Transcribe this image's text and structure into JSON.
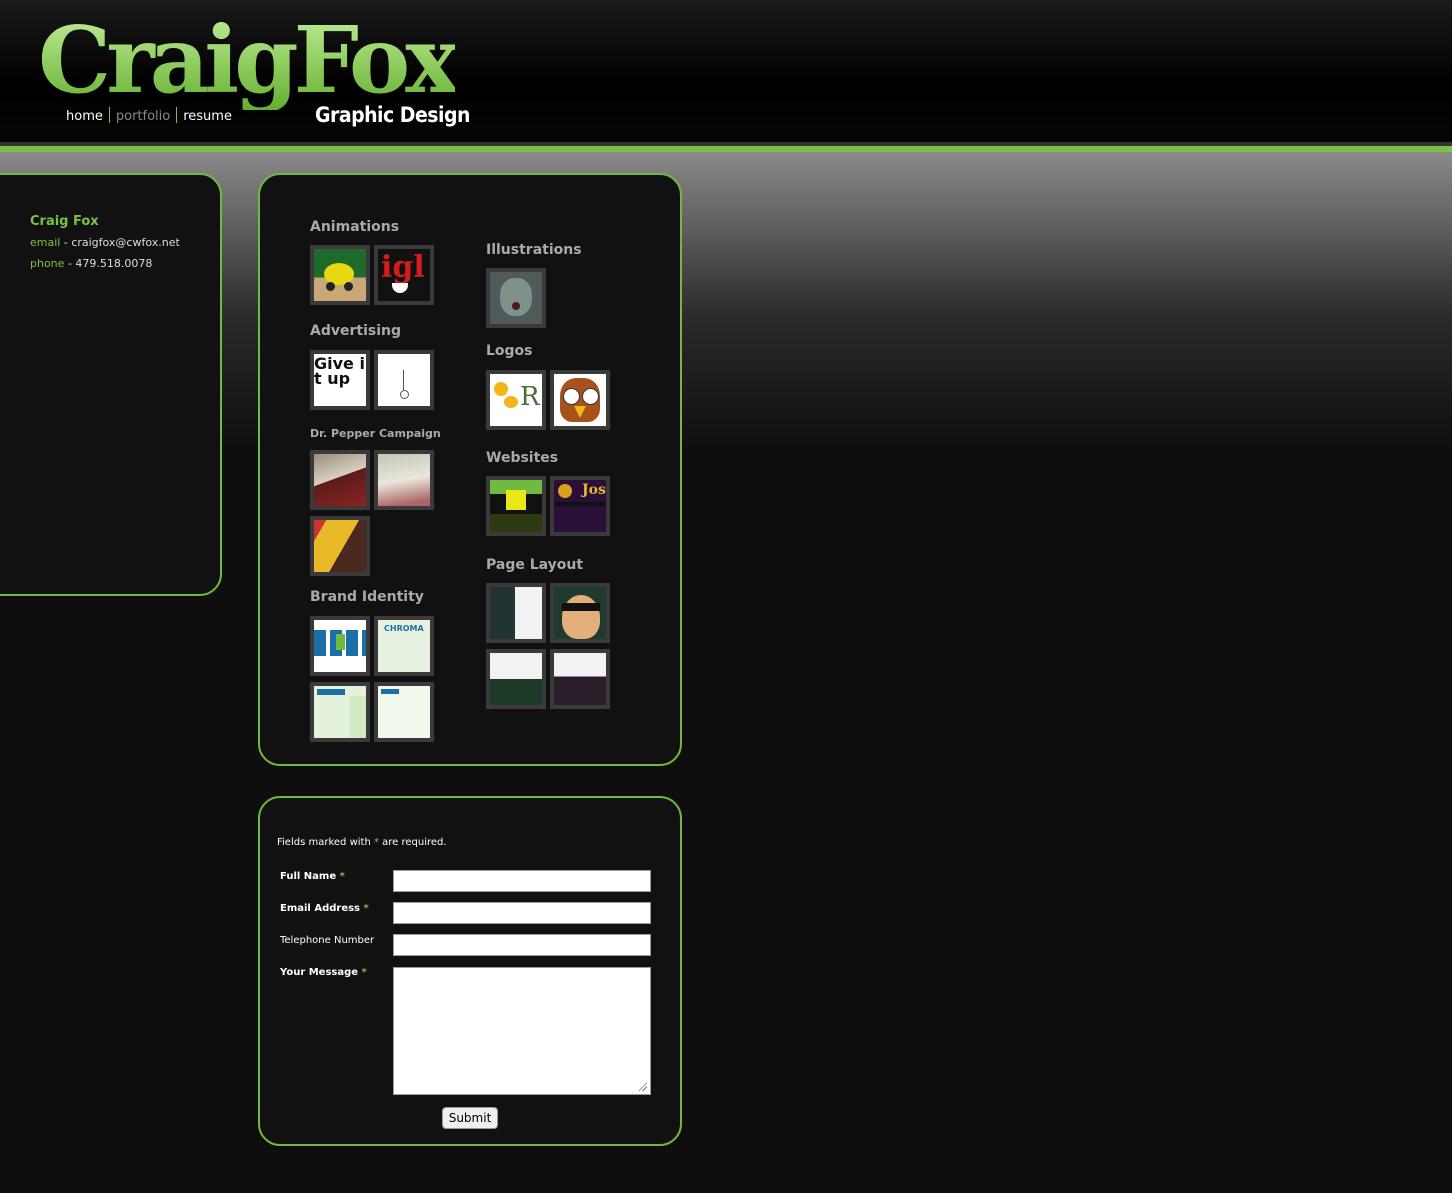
{
  "brand": {
    "name": "CraigFox",
    "tagline": "Graphic Design"
  },
  "nav": {
    "items": [
      {
        "label": "home",
        "active": false
      },
      {
        "label": "portfolio",
        "active": true
      },
      {
        "label": "resume",
        "active": false
      }
    ]
  },
  "contact": {
    "name": "Craig Fox",
    "email_label": "email",
    "email_sep": " - ",
    "email": "craigfox@cwfox.net",
    "phone_label": "phone",
    "phone_sep": " - ",
    "phone": "479.518.0078"
  },
  "portfolio": {
    "sections": [
      {
        "title": "Animations"
      },
      {
        "title": "Advertising"
      },
      {
        "title": "Dr. Pepper Campaign"
      },
      {
        "title": "Brand Identity"
      },
      {
        "title": "Illustrations"
      },
      {
        "title": "Logos"
      },
      {
        "title": "Websites"
      },
      {
        "title": "Page Layout"
      }
    ],
    "thumbnails": {
      "igl_text": "igl",
      "give_text": "Give it up",
      "chroma_text": "CHROMA",
      "rb_text": "R",
      "jos_text": "Jos"
    }
  },
  "form": {
    "note_prefix": "Fields marked with ",
    "note_star": "*",
    "note_suffix": " are required.",
    "full_name_label": "Full Name",
    "email_label": "Email Address",
    "phone_label": "Telephone Number",
    "message_label": "Your Message",
    "req_star": "*",
    "submit_label": "Submit"
  },
  "colors": {
    "accent": "#7bc146",
    "panel_bg": "#111111",
    "page_bg": "#0e0e0e"
  }
}
